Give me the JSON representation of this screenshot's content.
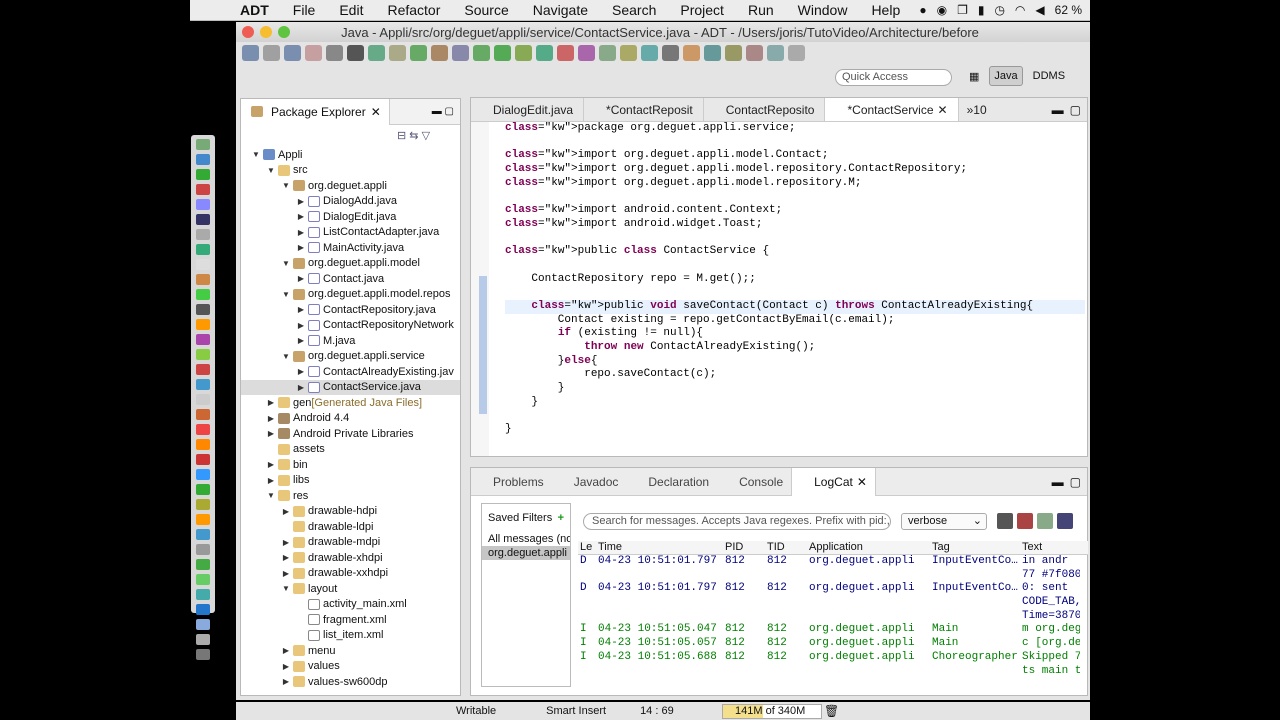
{
  "menubar": {
    "app": "ADT",
    "items": [
      "File",
      "Edit",
      "Refactor",
      "Source",
      "Navigate",
      "Search",
      "Project",
      "Run",
      "Window",
      "Help"
    ],
    "battery": "62 %"
  },
  "window": {
    "title": "Java - Appli/src/org/deguet/appli/service/ContactService.java - ADT - /Users/joris/TutoVideo/Architecture/before"
  },
  "toolbar": {
    "quick_access": "Quick Access",
    "perspectives": [
      "Java",
      "DDMS"
    ]
  },
  "package_explorer": {
    "title": "Package Explorer",
    "tree": [
      {
        "d": 0,
        "t": "open",
        "i": "proj",
        "label": "Appli"
      },
      {
        "d": 1,
        "t": "open",
        "i": "folder",
        "label": "src"
      },
      {
        "d": 2,
        "t": "open",
        "i": "pkg",
        "label": "org.deguet.appli"
      },
      {
        "d": 3,
        "t": "closed",
        "i": "java",
        "label": "DialogAdd.java"
      },
      {
        "d": 3,
        "t": "closed",
        "i": "java",
        "label": "DialogEdit.java"
      },
      {
        "d": 3,
        "t": "closed",
        "i": "java",
        "label": "ListContactAdapter.java"
      },
      {
        "d": 3,
        "t": "closed",
        "i": "java",
        "label": "MainActivity.java"
      },
      {
        "d": 2,
        "t": "open",
        "i": "pkg",
        "label": "org.deguet.appli.model"
      },
      {
        "d": 3,
        "t": "closed",
        "i": "java",
        "label": "Contact.java"
      },
      {
        "d": 2,
        "t": "open",
        "i": "pkg",
        "label": "org.deguet.appli.model.repos"
      },
      {
        "d": 3,
        "t": "closed",
        "i": "java",
        "label": "ContactRepository.java"
      },
      {
        "d": 3,
        "t": "closed",
        "i": "java",
        "label": "ContactRepositoryNetwork"
      },
      {
        "d": 3,
        "t": "closed",
        "i": "java",
        "label": "M.java"
      },
      {
        "d": 2,
        "t": "open",
        "i": "pkg",
        "label": "org.deguet.appli.service"
      },
      {
        "d": 3,
        "t": "closed",
        "i": "java",
        "label": "ContactAlreadyExisting.jav"
      },
      {
        "d": 3,
        "t": "closed",
        "i": "java",
        "label": "ContactService.java",
        "sel": true
      },
      {
        "d": 1,
        "t": "closed",
        "i": "folder",
        "label": "gen",
        "extra": "[Generated Java Files]"
      },
      {
        "d": 1,
        "t": "closed",
        "i": "lib",
        "label": "Android 4.4"
      },
      {
        "d": 1,
        "t": "closed",
        "i": "lib",
        "label": "Android Private Libraries"
      },
      {
        "d": 1,
        "t": "none",
        "i": "folder",
        "label": "assets"
      },
      {
        "d": 1,
        "t": "closed",
        "i": "folder",
        "label": "bin"
      },
      {
        "d": 1,
        "t": "closed",
        "i": "folder",
        "label": "libs"
      },
      {
        "d": 1,
        "t": "open",
        "i": "folder",
        "label": "res"
      },
      {
        "d": 2,
        "t": "closed",
        "i": "folder",
        "label": "drawable-hdpi"
      },
      {
        "d": 2,
        "t": "none",
        "i": "folder",
        "label": "drawable-ldpi"
      },
      {
        "d": 2,
        "t": "closed",
        "i": "folder",
        "label": "drawable-mdpi"
      },
      {
        "d": 2,
        "t": "closed",
        "i": "folder",
        "label": "drawable-xhdpi"
      },
      {
        "d": 2,
        "t": "closed",
        "i": "folder",
        "label": "drawable-xxhdpi"
      },
      {
        "d": 2,
        "t": "open",
        "i": "folder",
        "label": "layout"
      },
      {
        "d": 3,
        "t": "none",
        "i": "xml",
        "label": "activity_main.xml"
      },
      {
        "d": 3,
        "t": "none",
        "i": "xml",
        "label": "fragment.xml"
      },
      {
        "d": 3,
        "t": "none",
        "i": "xml",
        "label": "list_item.xml"
      },
      {
        "d": 2,
        "t": "closed",
        "i": "folder",
        "label": "menu"
      },
      {
        "d": 2,
        "t": "closed",
        "i": "folder",
        "label": "values"
      },
      {
        "d": 2,
        "t": "closed",
        "i": "folder",
        "label": "values-sw600dp"
      }
    ]
  },
  "editor": {
    "tabs": [
      {
        "label": "DialogEdit.java",
        "active": false
      },
      {
        "label": "*ContactReposit",
        "active": false
      },
      {
        "label": "ContactReposito",
        "active": false
      },
      {
        "label": "*ContactService",
        "active": true
      }
    ],
    "overflow": "»10",
    "cursor_pos": "14 : 69",
    "lines": [
      "package org.deguet.appli.service;",
      "",
      "import org.deguet.appli.model.Contact;",
      "import org.deguet.appli.model.repository.ContactRepository;",
      "import org.deguet.appli.model.repository.M;",
      "",
      "import android.content.Context;",
      "import android.widget.Toast;",
      "",
      "public class ContactService {",
      "",
      "    ContactRepository repo = M.get();;",
      "",
      "    public void saveContact(Contact c) throws ContactAlreadyExisting{",
      "        Contact existing = repo.getContactByEmail(c.email);",
      "        if (existing != null){",
      "            throw new ContactAlreadyExisting();",
      "        }else{",
      "            repo.saveContact(c);",
      "        }",
      "    }",
      "",
      "}"
    ]
  },
  "bottom_panel": {
    "tabs": [
      "Problems",
      "Javadoc",
      "Declaration",
      "Console",
      "LogCat"
    ],
    "active": "LogCat",
    "saved_filters": "Saved Filters",
    "filters": [
      "All messages (no",
      "org.deguet.appli"
    ],
    "search_placeholder": "Search for messages. Accepts Java regexes. Prefix with pid:,",
    "level": "verbose",
    "columns": [
      "Le",
      "Time",
      "PID",
      "TID",
      "Application",
      "Tag",
      "Text"
    ],
    "rows": [
      {
        "l": "D",
        "time": "04-23 10:51:01.797",
        "pid": "812",
        "tid": "812",
        "app": "org.deguet.appli",
        "tag": "InputEventCo…",
        "text": "in andr"
      },
      {
        "l": "",
        "time": "",
        "pid": "",
        "tid": "",
        "app": "",
        "tag": "",
        "text": "77 #7f080"
      },
      {
        "l": "D",
        "time": "04-23 10:51:01.797",
        "pid": "812",
        "tid": "812",
        "app": "org.deguet.appli",
        "tag": "InputEventCo…",
        "text": "0: sent"
      },
      {
        "l": "",
        "time": "",
        "pid": "",
        "tid": "",
        "app": "",
        "tag": "",
        "text": "CODE_TAB,"
      },
      {
        "l": "",
        "time": "",
        "pid": "",
        "tid": "",
        "app": "",
        "tag": "",
        "text": "Time=3870"
      },
      {
        "l": "I",
        "time": "04-23 10:51:05.047",
        "pid": "812",
        "tid": "812",
        "app": "org.deguet.appli",
        "tag": "Main",
        "text": "m org.deg"
      },
      {
        "l": "I",
        "time": "04-23 10:51:05.057",
        "pid": "812",
        "tid": "812",
        "app": "org.deguet.appli",
        "tag": "Main",
        "text": "c [org.de"
      },
      {
        "l": "I",
        "time": "04-23 10:51:05.688",
        "pid": "812",
        "tid": "812",
        "app": "org.deguet.appli",
        "tag": "Choreographer",
        "text": "Skipped 7"
      },
      {
        "l": "",
        "time": "",
        "pid": "",
        "tid": "",
        "app": "",
        "tag": "",
        "text": "ts main t"
      }
    ]
  },
  "statusbar": {
    "writable": "Writable",
    "insert": "Smart Insert",
    "position": "14 : 69",
    "memory": "141M of 340M",
    "memory_fraction": 0.41
  }
}
